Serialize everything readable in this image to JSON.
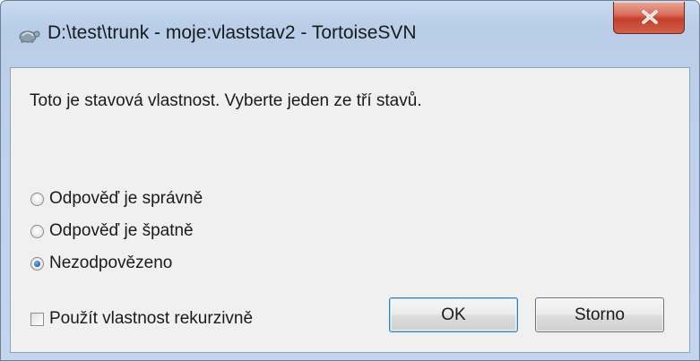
{
  "window": {
    "title": "D:\\test\\trunk - moje:vlaststav2 - TortoiseSVN",
    "app_icon": "tortoisesvn-icon",
    "close_icon": "close-icon",
    "close_color": "#c4402a"
  },
  "dialog": {
    "description": "Toto je stavová vlastnost. Vyberte jeden ze tří stavů.",
    "options": [
      {
        "label": "Odpověď je správně",
        "checked": false
      },
      {
        "label": "Odpověď je špatně",
        "checked": false
      },
      {
        "label": "Nezodpovězeno",
        "checked": true
      }
    ],
    "recursive_checkbox": {
      "label": "Použít vlastnost rekurzivně",
      "checked": false
    },
    "ok_label": "OK",
    "cancel_label": "Storno"
  }
}
